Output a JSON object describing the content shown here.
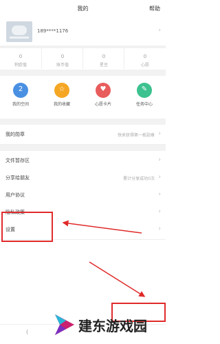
{
  "header": {
    "title": "我的",
    "help": "帮助"
  },
  "profile": {
    "phone": "189****1176"
  },
  "stats": [
    {
      "value": "0",
      "label": "积欧值"
    },
    {
      "value": "0",
      "label": "账币值"
    },
    {
      "value": "0",
      "label": "星豆"
    },
    {
      "value": "0",
      "label": "心愿"
    }
  ],
  "quick_actions": [
    {
      "label": "我的空间",
      "color": "#4a90e2",
      "icon": "2"
    },
    {
      "label": "我的收藏",
      "color": "#f5a623",
      "icon": "☆"
    },
    {
      "label": "心愿卡片",
      "color": "#e85c5c",
      "icon": "♥"
    },
    {
      "label": "任务中心",
      "color": "#3cc18f",
      "icon": "✎"
    }
  ],
  "menu": [
    {
      "label": "我的勋章",
      "hint": "快来获得第一枚勋章"
    },
    {
      "label": "文件暂存区",
      "hint": ""
    },
    {
      "label": "分享给朋友",
      "hint": "累计分享成功0次"
    },
    {
      "label": "用户协议",
      "hint": ""
    },
    {
      "label": "隐私政策",
      "hint": ""
    },
    {
      "label": "设置",
      "hint": ""
    }
  ],
  "watermark": {
    "text": "建东游戏园"
  },
  "bottom_bar": {
    "fragment": "("
  },
  "colors": {
    "annotation_red": "#e02a2a"
  }
}
